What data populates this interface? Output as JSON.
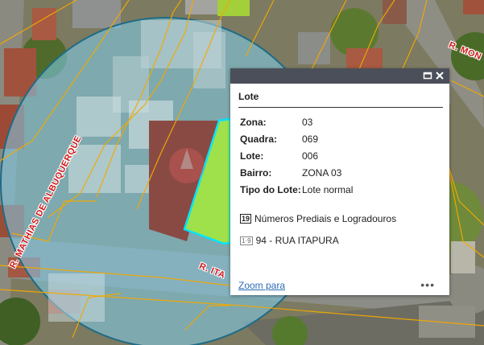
{
  "map": {
    "street_labels": [
      "R. MATHIAS DE ALBUQUERQUE",
      "R. MON",
      "R. ITA"
    ],
    "colors": {
      "roof": "#a0523d",
      "selection_fill": "#9fe14a",
      "selection_outline": "#00e5ff",
      "buffer_fill": "#7fd0ee",
      "parcel_line": "#f2a900",
      "street_label": "#d01818"
    }
  },
  "popup": {
    "title": "Lote",
    "fields": [
      {
        "key": "Zona:",
        "value": "03"
      },
      {
        "key": "Quadra:",
        "value": "069"
      },
      {
        "key": "Lote:",
        "value": "006"
      },
      {
        "key": "Bairro:",
        "value": "ZONA 03"
      },
      {
        "key": "Tipo do Lote:",
        "value": "Lote normal"
      }
    ],
    "related": {
      "badge": "19",
      "title": "Números Prediais e Logradouros",
      "badge_small": "1·9",
      "item": "94 - RUA ITAPURA"
    },
    "zoom_link": "Zoom para",
    "more": "•••",
    "icons": [
      "maximize-icon",
      "close-icon",
      "more-icon"
    ]
  }
}
